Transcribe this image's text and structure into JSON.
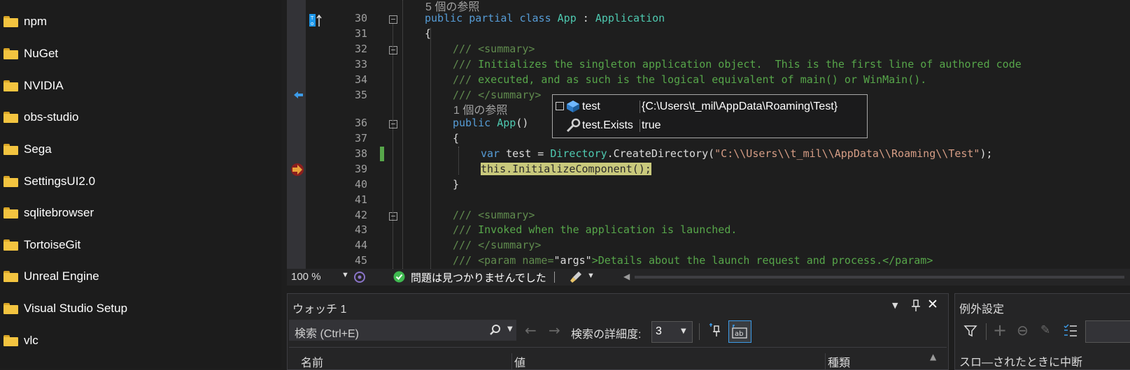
{
  "explorer": {
    "folders": [
      {
        "label": "npm"
      },
      {
        "label": "NuGet"
      },
      {
        "label": "NVIDIA"
      },
      {
        "label": "obs-studio"
      },
      {
        "label": "Sega"
      },
      {
        "label": "SettingsUI2.0"
      },
      {
        "label": "sqlitebrowser"
      },
      {
        "label": "TortoiseGit"
      },
      {
        "label": "Unreal Engine"
      },
      {
        "label": "Visual Studio Setup"
      },
      {
        "label": "vlc"
      }
    ]
  },
  "editor": {
    "refs_top": "5 個の参照",
    "refs_ctor": "1 個の参照",
    "line_numbers": [
      "30",
      "31",
      "32",
      "33",
      "34",
      "35",
      "36",
      "37",
      "38",
      "39",
      "40",
      "41",
      "42",
      "43",
      "44",
      "45"
    ],
    "code": {
      "l30_public": "public",
      "l30_partial": "partial",
      "l30_class": "class",
      "l30_app": "App",
      "l30_colon": ":",
      "l30_base": "Application",
      "l31": "{",
      "l32_slashes": "///",
      "l32_tag": "<summary>",
      "l33_slashes": "///",
      "l33_text": "Initializes the singleton application object.  This is the first line of authored code",
      "l34_slashes": "///",
      "l34_text": "executed, and as such is the logical equivalent of main() or WinMain().",
      "l35_slashes": "///",
      "l35_tag": "</summary>",
      "l36_public": "public",
      "l36_app": "App",
      "l36_parens": "()",
      "l37": "{",
      "l38_var": "var",
      "l38_test": "test",
      "l38_eq": " = ",
      "l38_dir": "Directory",
      "l38_call": ".CreateDirectory(",
      "l38_str": "\"C:\\\\Users\\\\t_mil\\\\AppData\\\\Roaming\\\\Test\"",
      "l38_end": ");",
      "l39_this": "this",
      "l39_rest": ".InitializeComponent();",
      "l40": "}",
      "l42_slashes": "///",
      "l42_tag": "<summary>",
      "l43_slashes": "///",
      "l43_text": "Invoked when the application is launched.",
      "l44_slashes": "///",
      "l44_tag": "</summary>",
      "l45_slashes": "///",
      "l45_open": "<param name=",
      "l45_attr": "\"args\"",
      "l45_close": ">Details about the launch request and process.</param>"
    }
  },
  "tooltip": {
    "rows": [
      {
        "name": "test",
        "value": "{C:\\Users\\t_mil\\AppData\\Roaming\\Test}"
      },
      {
        "name": "test.Exists",
        "value": "true"
      }
    ]
  },
  "status_bar": {
    "zoom": "100 %",
    "issues": "問題は見つかりませんでした"
  },
  "watch": {
    "title": "ウォッチ 1",
    "search_placeholder": "検索 (Ctrl+E)",
    "depth_label": "検索の詳細度:",
    "depth_value": "3",
    "columns": [
      "名前",
      "値",
      "種類"
    ]
  },
  "exceptions": {
    "title": "例外設定",
    "partial_text": "スロ―されたときに中断"
  },
  "colors": {
    "accent": "#569cd6",
    "folder": "#f3c440",
    "breakpoint_arrow": "#e8a23a"
  }
}
